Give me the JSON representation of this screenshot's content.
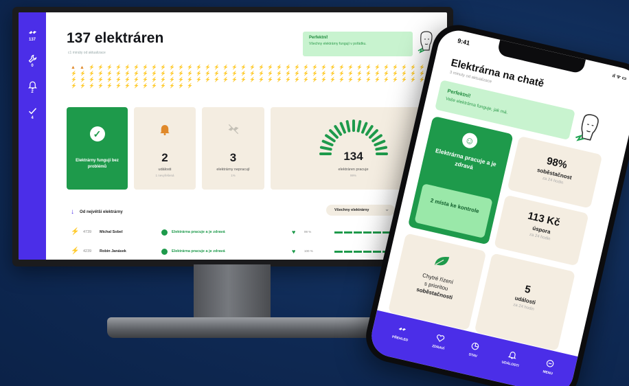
{
  "desktop": {
    "sidebar": [
      {
        "icon": "bolt-icon",
        "badge": "137"
      },
      {
        "icon": "wrench-icon",
        "badge": "0"
      },
      {
        "icon": "bell-icon",
        "badge": "2"
      },
      {
        "icon": "check-icon",
        "badge": "4"
      }
    ],
    "title": "137 elektráren",
    "subtitle": "c1 minúty od aktualizace",
    "toast": {
      "title": "Perfektní!",
      "text": "Všechny elektrárny fungují v pořádku."
    },
    "summary": {
      "ok_label": "Elektrárny fungují bez problémů",
      "events_value": "2",
      "events_label": "události",
      "events_sub": "1 nevyřešená",
      "down_value": "3",
      "down_label": "elektrárny nepracují",
      "down_sub": "1%",
      "gauge_value": "134",
      "gauge_label": "elektráren pracuje",
      "gauge_sub": "99%"
    },
    "sort_label": "Od největší elektrárny",
    "filter_label": "Všechny elektrárny",
    "filter_icon": "filter-icon",
    "rows": [
      {
        "id": "4739",
        "name": "Michal Sobel",
        "status": "Elektrárna pracuje a je zdravá",
        "pct": "99 %"
      },
      {
        "id": "4239",
        "name": "Robin Janásek",
        "status": "Elektrárna pracuje a je zdravá",
        "pct": "100 %"
      }
    ]
  },
  "phone": {
    "time": "9:41",
    "status_icons": "ıl ᯤ ▭",
    "title": "Elektrárna na chatě",
    "subtitle": "3 minuty od aktualizace",
    "toast": {
      "title": "Perfektní!",
      "text": "Vaše elektrárna funguje, jak má."
    },
    "ok_label": "Elektrárna pracuje a je zdravá",
    "check_label": "2 místa ke kontrole",
    "self_value": "98%",
    "self_label": "soběstačnost",
    "self_sub": "za 24 hodin",
    "save_value": "113 Kč",
    "save_label": "úspora",
    "save_sub": "za 24 hodin",
    "smart_line1": "Chytré řízení",
    "smart_line2": "s prioritou",
    "smart_line3": "soběstačnosti",
    "events_value": "5",
    "events_label": "události",
    "events_sub": "za 24 hodin",
    "nav": [
      "PŘEHLED",
      "ZDRAVÍ",
      "STAV",
      "UDÁLOSTI",
      "MENU"
    ]
  },
  "colors": {
    "brand": "#4b2ee8",
    "ok": "#1e9a4b",
    "warn": "#e0892a",
    "tile": "#f4ede1"
  }
}
